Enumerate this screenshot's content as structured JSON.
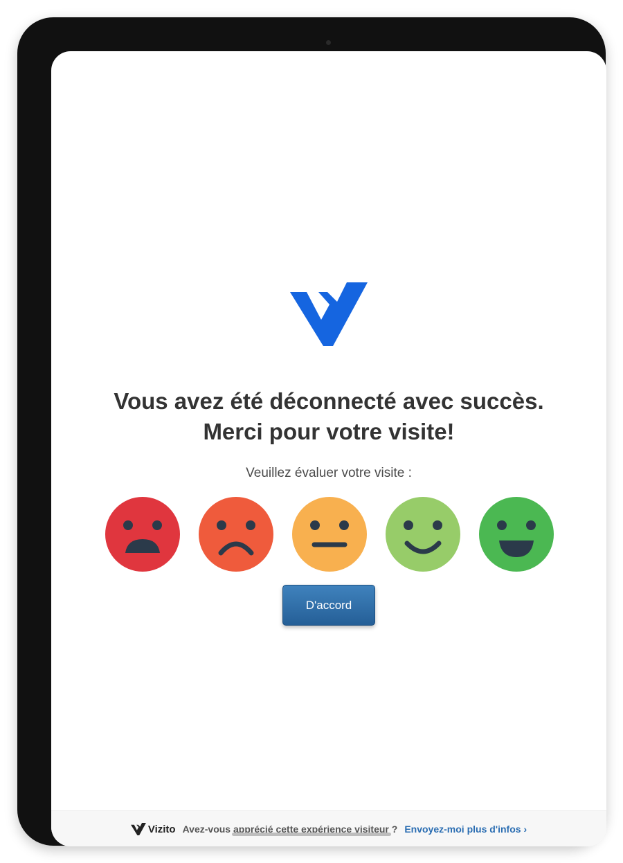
{
  "headline": {
    "line1": "Vous avez été déconnecté avec succès.",
    "line2": "Merci pour votre visite!"
  },
  "prompt": "Veuillez évaluer votre visite :",
  "rating": {
    "faces": [
      {
        "name": "very-unhappy-face-icon",
        "color": "#e0363e"
      },
      {
        "name": "sad-face-icon",
        "color": "#ef5b3c"
      },
      {
        "name": "neutral-face-icon",
        "color": "#f8b04f"
      },
      {
        "name": "smiling-face-icon",
        "color": "#97cc69"
      },
      {
        "name": "grinning-face-icon",
        "color": "#4bb852"
      }
    ]
  },
  "ok_button_label": "D'accord",
  "footer": {
    "brand": "Vizito",
    "question": "Avez-vous apprécié cette expérience visiteur ?",
    "link": "Envoyez-moi plus d'infos ›"
  },
  "colors": {
    "brand_blue": "#1565e0",
    "button_blue": "#2f6fad",
    "link_blue": "#2a6db2",
    "face_feature": "#2b3a4a"
  }
}
